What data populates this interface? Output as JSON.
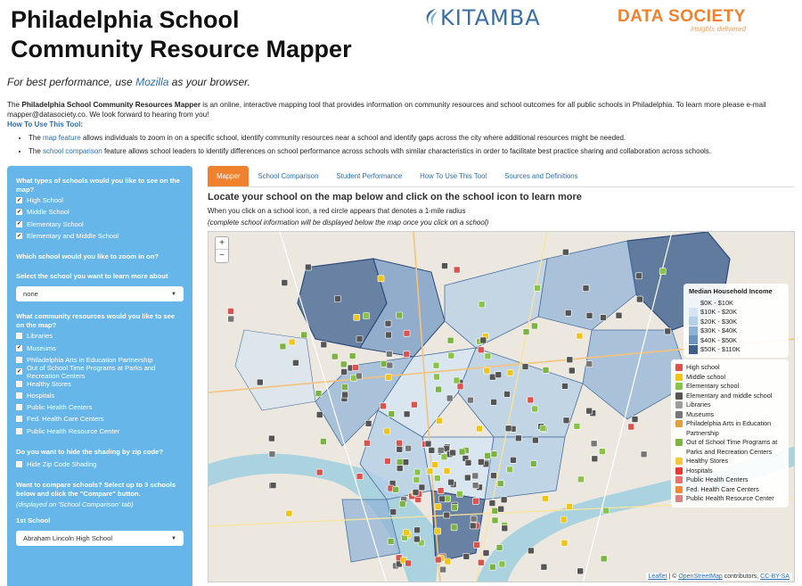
{
  "header": {
    "title_line1": "Philadelphia School",
    "title_line2": "Community Resource Mapper",
    "logo_kitamba": "KITAMBA",
    "logo_ds": "DATA SOCIETY",
    "logo_ds_tag": "insights delivered"
  },
  "performance": {
    "prefix": "For best performance, use ",
    "link": "Mozilla",
    "suffix": " as your browser."
  },
  "intro": {
    "pre": "The ",
    "bold": "Philadelphia School Community Resources Mapper",
    "rest": " is an online, interactive mapping tool that provides information on community resources and school outcomes for all public schools in Philadelphia. To learn more please e-mail mapper@datasociety.co. We look forward to hearing from you!"
  },
  "howto": {
    "heading": "How To Use This Tool:",
    "bullets": [
      {
        "pre": "The ",
        "link": "map feature",
        "rest": " allows individuals to zoom in on a specific school, identify community resources near a school and identify gaps across the city where additional resources might be needed."
      },
      {
        "pre": "The ",
        "link": "school comparison",
        "rest": " feature allows school leaders to identify differences on school performance across schools with similar characteristics in order to facilitate best practice sharing and collaboration across schools."
      }
    ]
  },
  "sidebar": {
    "q_types": "What types of schools would you like to see on the map?",
    "school_types": [
      {
        "label": "High School",
        "checked": true
      },
      {
        "label": "Middle School",
        "checked": true
      },
      {
        "label": "Elementary School",
        "checked": true
      },
      {
        "label": "Elementary and Middle School",
        "checked": true
      }
    ],
    "q_zoom": "Which school would you like to zoom in on?",
    "q_select": "Select the school you want to learn more about",
    "select_value": "none",
    "q_resources": "What community resources would you like to see on the map?",
    "resources": [
      {
        "label": "Libraries",
        "checked": false
      },
      {
        "label": "Museums",
        "checked": true
      },
      {
        "label": "Philadelphia Arts in Education Partnership",
        "checked": false
      },
      {
        "label": "Out of School Time Programs at Parks and Recreation Centers",
        "checked": true
      },
      {
        "label": "Healthy Stores",
        "checked": false
      },
      {
        "label": "Hospitals",
        "checked": false
      },
      {
        "label": "Public Health Centers",
        "checked": false
      },
      {
        "label": "Fed. Health Care Centers",
        "checked": false
      },
      {
        "label": "Public Health Resource Center",
        "checked": false
      }
    ],
    "q_shading": "Do you want to hide the shading by zip code?",
    "shading_option": {
      "label": "Hide Zip Code Shading",
      "checked": false
    },
    "q_compare": "Want to compare schools? Select up to 3 schools below and click the \"Compare\" button.",
    "compare_note": "(displayed on 'School Comparison' tab)",
    "first_school_label": "1st School",
    "first_school_value": "Abraham Lincoln High School"
  },
  "tabs": [
    {
      "label": "Mapper",
      "active": true
    },
    {
      "label": "School Comparison",
      "active": false
    },
    {
      "label": "Student Performance",
      "active": false
    },
    {
      "label": "How To Use This Tool",
      "active": false
    },
    {
      "label": "Sources and Definitions",
      "active": false
    }
  ],
  "map_panel": {
    "heading": "Locate your school on the map below and click on the school icon to learn more",
    "sub1": "When you click on a school icon, a red circle appears that denotes a 1-mile radius",
    "sub2": "(complete school information will be displayed below the map once you click on a school)",
    "zoom_in": "+",
    "zoom_out": "−"
  },
  "income_legend": {
    "title": "Median Household Income",
    "items": [
      {
        "label": "$0K - $10K",
        "color": "#eef4fa"
      },
      {
        "label": "$10K - $20K",
        "color": "#d4e4f2"
      },
      {
        "label": "$20K - $30K",
        "color": "#b4cfe6"
      },
      {
        "label": "$30K - $40K",
        "color": "#8eb2d6"
      },
      {
        "label": "$40K - $50K",
        "color": "#6b94c2"
      },
      {
        "label": "$50K - $110K",
        "color": "#3e5f8e"
      }
    ]
  },
  "icon_legend": {
    "items": [
      {
        "label": "High school",
        "color": "#d9534f",
        "icon": "high-school-icon"
      },
      {
        "label": "Middle school",
        "color": "#f0c419",
        "icon": "middle-school-icon"
      },
      {
        "label": "Elementary school",
        "color": "#8bc34a",
        "icon": "elementary-school-icon"
      },
      {
        "label": "Elementary and middle school",
        "color": "#555555",
        "icon": "elem-middle-school-icon"
      },
      {
        "label": "Libraries",
        "color": "#9e9e9e",
        "icon": "library-icon"
      },
      {
        "label": "Museums",
        "color": "#777777",
        "icon": "museum-icon"
      },
      {
        "label": "Philadelphia Arts in Education Partnership",
        "color": "#e0a040",
        "icon": "arts-icon"
      },
      {
        "label": "Out of School Time Programs at Parks and Recreation Centers",
        "color": "#7cb342",
        "icon": "park-icon"
      },
      {
        "label": "Healthy Stores",
        "color": "#f5c842",
        "icon": "healthy-store-icon"
      },
      {
        "label": "Hospitals",
        "color": "#e53935",
        "icon": "hospital-icon"
      },
      {
        "label": "Public Health Centers",
        "color": "#e57373",
        "icon": "public-health-icon"
      },
      {
        "label": "Fed. Health Care Centers",
        "color": "#ef8a3c",
        "icon": "fed-health-icon"
      },
      {
        "label": "Public Health Resource Center",
        "color": "#d98080",
        "icon": "resource-center-icon"
      }
    ]
  },
  "attribution": {
    "leaflet": "Leaflet",
    "sep": " | © ",
    "osm": "OpenStreetMap",
    "mid": " contributors, ",
    "license": "CC-BY-SA"
  }
}
